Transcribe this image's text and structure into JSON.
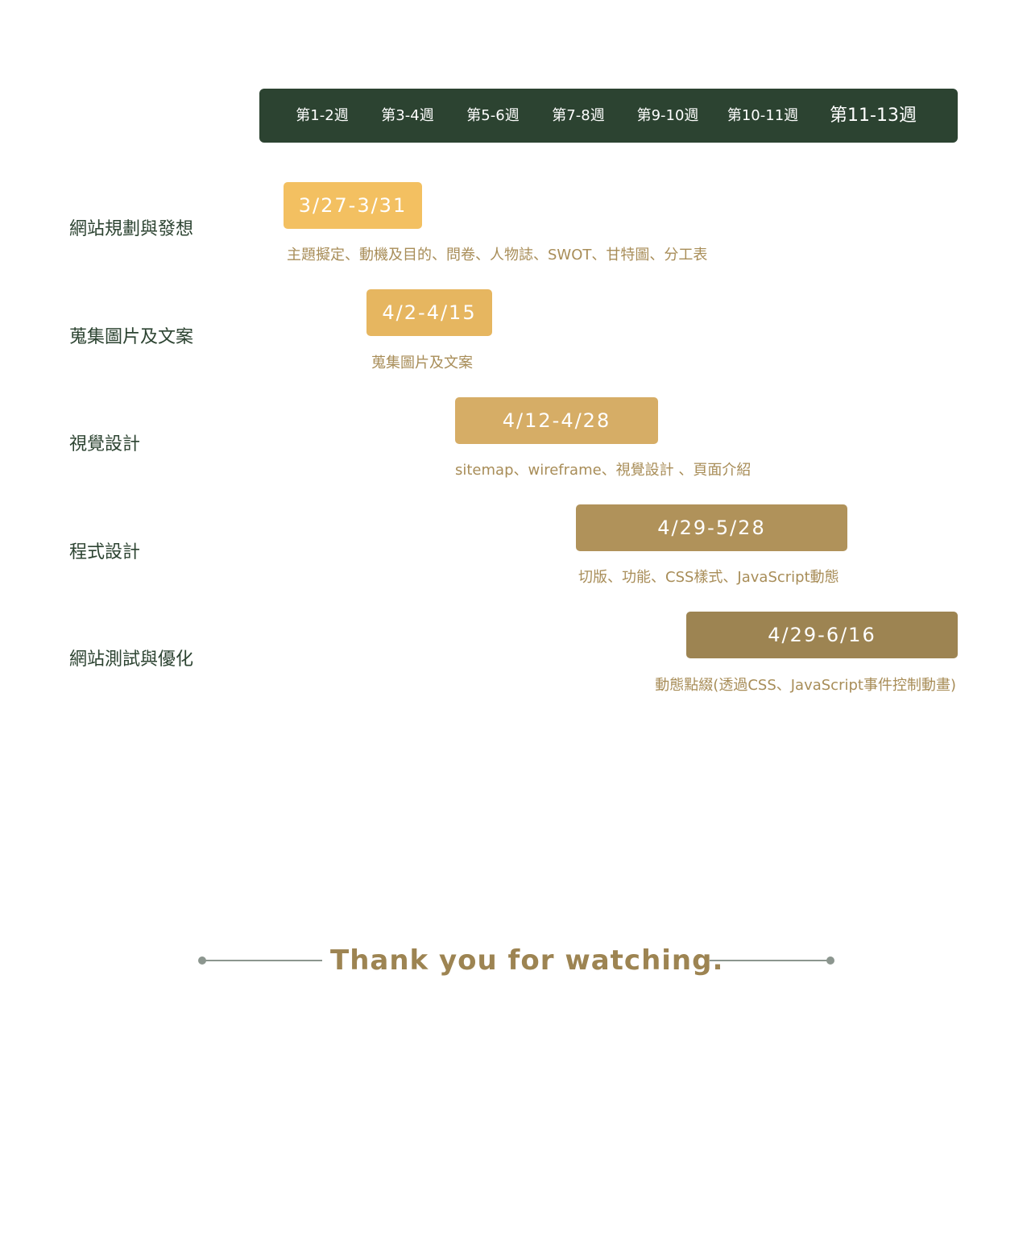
{
  "chart_data": {
    "type": "gantt",
    "weeks": [
      "第1-2週",
      "第3-4週",
      "第5-6週",
      "第7-8週",
      "第9-10週",
      "第10-11週",
      "第11-13週"
    ],
    "tasks": [
      {
        "name": "網站規劃與發想",
        "range": "3/27-3/31",
        "detail": "主題擬定、動機及目的、問卷、人物誌、SWOT、甘特圖、分工表",
        "color": "#f3c061",
        "start": 3.27,
        "end": 3.31
      },
      {
        "name": "蒐集圖片及文案",
        "range": "4/2-4/15",
        "detail": "蒐集圖片及文案",
        "color": "#e6b660",
        "start": 4.02,
        "end": 4.15
      },
      {
        "name": "視覺設計",
        "range": "4/12-4/28",
        "detail": "sitemap、wireframe、視覺設計 、頁面介紹",
        "color": "#d6ad66",
        "start": 4.12,
        "end": 4.28
      },
      {
        "name": "程式設計",
        "range": "4/29-5/28",
        "detail": "切版、功能、CSS樣式、JavaScript動態",
        "color": "#b0925a",
        "start": 4.29,
        "end": 5.28
      },
      {
        "name": "網站測試與優化",
        "range": "4/29-6/16",
        "detail": "動態點綴(透過CSS、JavaScript事件控制動畫)",
        "color": "#9d8452",
        "start": 4.29,
        "end": 6.16
      }
    ]
  },
  "colors": {
    "header_bg": "#2c4331",
    "task_label": "#2c4331",
    "detail_text": "#a88d58",
    "thanks_text": "#9d8452",
    "thanks_line": "#8c968f"
  },
  "footer": {
    "thanks": "Thank you for watching."
  }
}
